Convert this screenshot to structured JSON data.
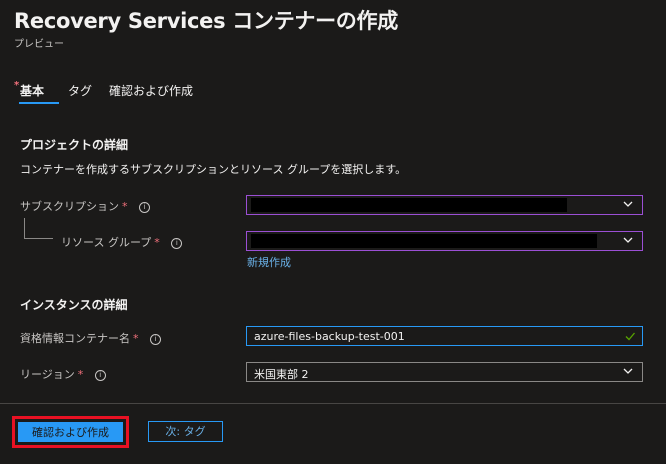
{
  "header": {
    "title": "Recovery Services コンテナーの作成",
    "more": "···",
    "subtitle": "プレビュー"
  },
  "tabs": [
    {
      "label": "基本",
      "required_marker": "*"
    },
    {
      "label": "タグ"
    },
    {
      "label": "確認および作成"
    }
  ],
  "project": {
    "section_title": "プロジェクトの詳細",
    "description": "コンテナーを作成するサブスクリプションとリソース グループを選択します。",
    "subscription_label": "サブスクリプション",
    "resource_group_label": "リソース グループ",
    "create_new_link": "新規作成"
  },
  "instance": {
    "section_title": "インスタンスの詳細",
    "vault_name_label": "資格情報コンテナー名",
    "vault_name_value": "azure-files-backup-test-001",
    "region_label": "リージョン",
    "region_value": "米国東部 2"
  },
  "common": {
    "required_star": "*",
    "info_glyph": "i"
  },
  "footer": {
    "review_create_label": "確認および作成",
    "next_tags_label": "次: タグ"
  },
  "colors": {
    "background": "#1b1a19",
    "accent": "#2899f5",
    "focus_border": "#9b4fd4",
    "highlight_red": "#e81123",
    "required": "#f1707b"
  }
}
